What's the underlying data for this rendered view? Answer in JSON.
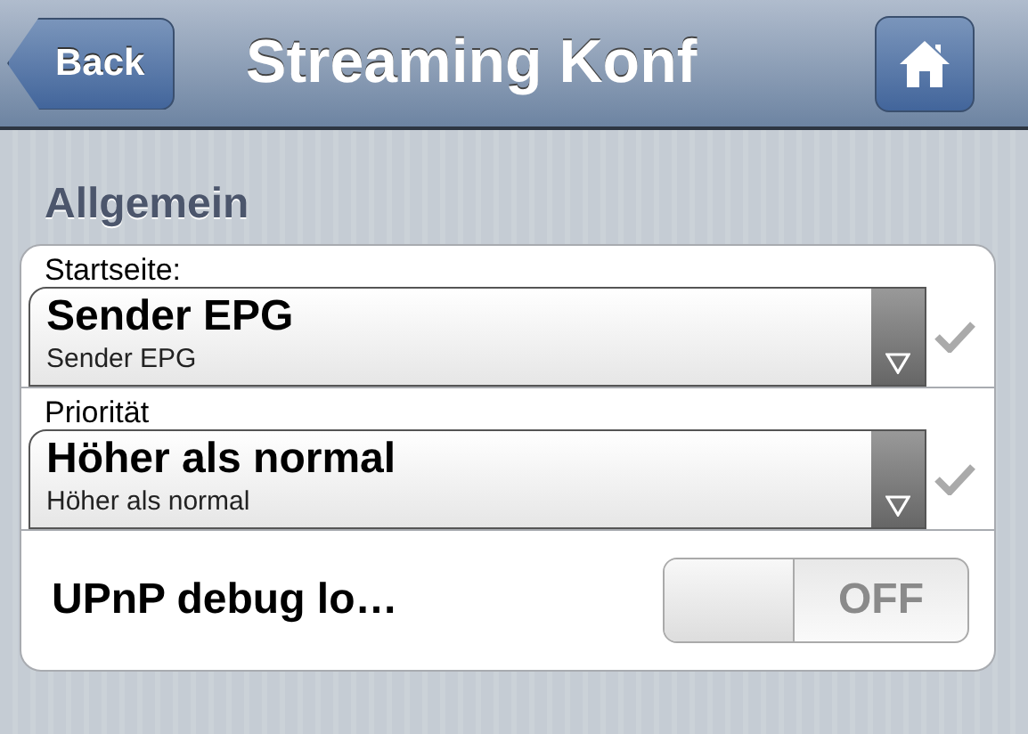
{
  "nav": {
    "back": "Back",
    "title": "Streaming Konf"
  },
  "section": "Allgemein",
  "rows": [
    {
      "kind": "select",
      "label": "Startseite:",
      "value": "Sender EPG",
      "option": "Sender EPG"
    },
    {
      "kind": "select",
      "label": "Priorität",
      "value": "Höher als normal",
      "option": "Höher als normal"
    },
    {
      "kind": "toggle",
      "label": "UPnP debug lo…",
      "on": false,
      "state_text": "OFF"
    }
  ]
}
